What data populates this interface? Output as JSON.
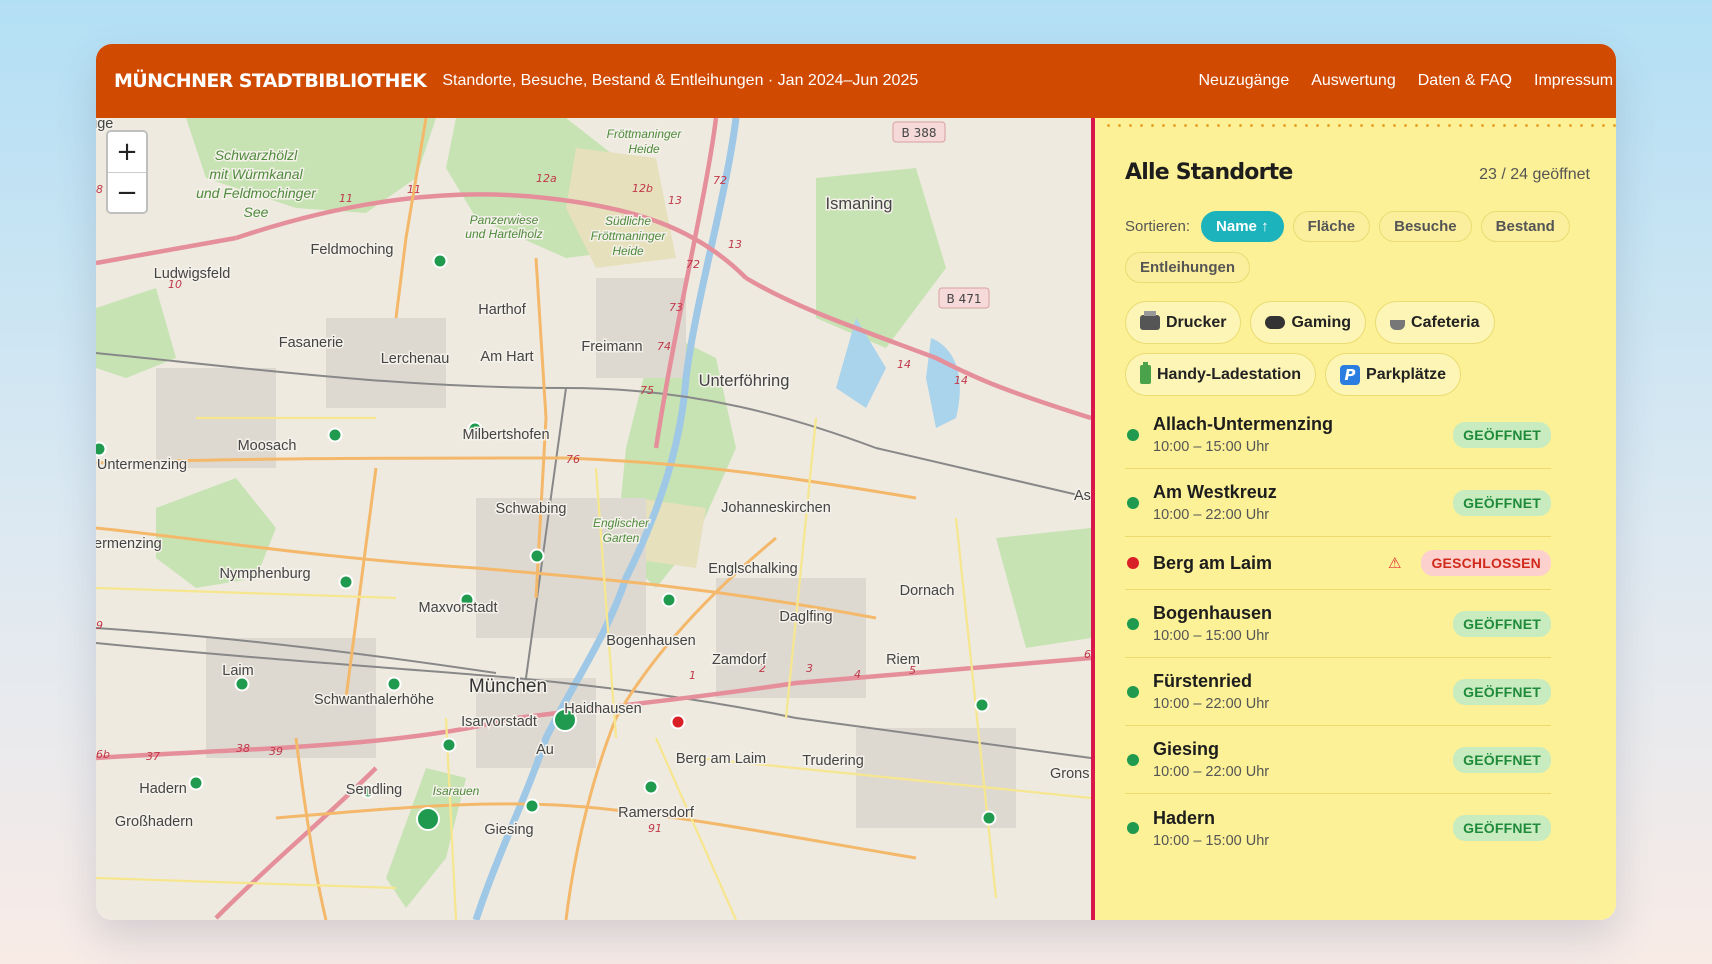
{
  "header": {
    "brand": "MÜNCHNER STADTBIBLIOTHEK",
    "subtitle": "Standorte, Besuche, Bestand & Entleihungen · Jan 2024–Jun 2025",
    "nav": [
      "Neuzugänge",
      "Auswertung",
      "Daten & FAQ",
      "Impressum"
    ],
    "color": "#d14a02"
  },
  "map": {
    "zoom_in": "+",
    "zoom_out": "−",
    "labels": [
      {
        "text": "Schwarzhölzl",
        "italic": true
      },
      {
        "text": "mit Würmkanal",
        "italic": true
      },
      {
        "text": "und Feldmochinger",
        "italic": true
      },
      {
        "text": "See",
        "italic": true
      },
      {
        "text": "Fröttmaninger",
        "italic": true
      },
      {
        "text": "Heide",
        "italic": true
      },
      {
        "text": "Panzerwiese",
        "italic": true
      },
      {
        "text": "und Hartelholz",
        "italic": true
      },
      {
        "text": "Südliche",
        "italic": true
      },
      {
        "text": "Fröttmaninger",
        "italic": true
      },
      {
        "text": "Heide",
        "italic": true
      },
      {
        "text": "Ismaning"
      },
      {
        "text": "Feldmoching"
      },
      {
        "text": "Ludwigsfeld"
      },
      {
        "text": "Harthof"
      },
      {
        "text": "Fasanerie"
      },
      {
        "text": "Lerchenau"
      },
      {
        "text": "Am Hart"
      },
      {
        "text": "Freimann"
      },
      {
        "text": "Unterföhring"
      },
      {
        "text": "Moosach"
      },
      {
        "text": "Untermenzing"
      },
      {
        "text": "Milbertshofen"
      },
      {
        "text": "Schwabing"
      },
      {
        "text": "Englischer",
        "italic": true
      },
      {
        "text": "Garten",
        "italic": true
      },
      {
        "text": "Johanneskirchen"
      },
      {
        "text": "Nymphenburg"
      },
      {
        "text": "Englschalking"
      },
      {
        "text": "Maxvorstadt"
      },
      {
        "text": "Dornach"
      },
      {
        "text": "Daglfing"
      },
      {
        "text": "Bogenhausen"
      },
      {
        "text": "Zamdorf"
      },
      {
        "text": "Laim"
      },
      {
        "text": "Riem"
      },
      {
        "text": "Schwanthalerhöhe"
      },
      {
        "text": "München"
      },
      {
        "text": "Haidhausen"
      },
      {
        "text": "Isarvorstadt"
      },
      {
        "text": "Au"
      },
      {
        "text": "Berg am Laim"
      },
      {
        "text": "Trudering"
      },
      {
        "text": "Hadern"
      },
      {
        "text": "Sendling"
      },
      {
        "text": "Isarauen",
        "italic": true
      },
      {
        "text": "Ramersdorf"
      },
      {
        "text": "Großhadern"
      },
      {
        "text": "Giesing"
      },
      {
        "text": "ermenzing"
      },
      {
        "text": "Grons"
      },
      {
        "text": "As"
      },
      {
        "text": "ige"
      }
    ],
    "road_shields": [
      "B 388",
      "B 471"
    ],
    "road_numbers": [
      "11",
      "11",
      "12a",
      "12b",
      "13",
      "72",
      "72",
      "13",
      "73",
      "74",
      "75",
      "76",
      "14",
      "14",
      "10",
      "1",
      "2",
      "3",
      "4",
      "5",
      "6",
      "37",
      "38",
      "39",
      "6b",
      "91",
      "9",
      "8"
    ]
  },
  "panel": {
    "title": "Alle Standorte",
    "count": "23 / 24 geöffnet",
    "sort_label": "Sortieren:",
    "sort_options": [
      {
        "label": "Name ↑",
        "active": true
      },
      {
        "label": "Fläche",
        "active": false
      },
      {
        "label": "Besuche",
        "active": false
      },
      {
        "label": "Bestand",
        "active": false
      },
      {
        "label": "Entleihungen",
        "active": false
      }
    ],
    "filters": [
      {
        "label": "Drucker",
        "icon": "printer-icon"
      },
      {
        "label": "Gaming",
        "icon": "gamepad-icon"
      },
      {
        "label": "Cafeteria",
        "icon": "coffee-icon"
      },
      {
        "label": "Handy-Ladestation",
        "icon": "battery-icon"
      },
      {
        "label": "Parkplätze",
        "icon": "parking-icon"
      }
    ],
    "locations": [
      {
        "name": "Allach-Untermenzing",
        "hours": "10:00 – 15:00 Uhr",
        "status": "GEÖFFNET",
        "open": true
      },
      {
        "name": "Am Westkreuz",
        "hours": "10:00 – 22:00 Uhr",
        "status": "GEÖFFNET",
        "open": true
      },
      {
        "name": "Berg am Laim",
        "hours": "",
        "status": "GESCHLOSSEN",
        "open": false,
        "warning": "⚠"
      },
      {
        "name": "Bogenhausen",
        "hours": "10:00 – 15:00 Uhr",
        "status": "GEÖFFNET",
        "open": true
      },
      {
        "name": "Fürstenried",
        "hours": "10:00 – 22:00 Uhr",
        "status": "GEÖFFNET",
        "open": true
      },
      {
        "name": "Giesing",
        "hours": "10:00 – 22:00 Uhr",
        "status": "GEÖFFNET",
        "open": true
      },
      {
        "name": "Hadern",
        "hours": "10:00 – 15:00 Uhr",
        "status": "GEÖFFNET",
        "open": true
      }
    ],
    "colors": {
      "background": "#fcf196",
      "accent": "#1db3bd",
      "open": "#1f9a4e",
      "closed": "#d92027",
      "divider": "#d9174b"
    }
  }
}
